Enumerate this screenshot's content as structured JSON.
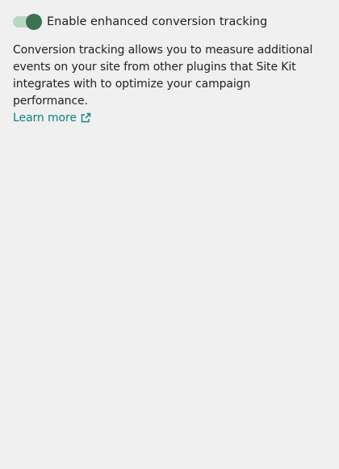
{
  "toggle": {
    "label": "Enable enhanced conversion tracking",
    "checked": true,
    "track_color": "#b8d8c4",
    "thumb_color": "#3c7251"
  },
  "description": {
    "text": "Conversion tracking allows you to measure additional events on your site from other plugins that Site Kit integrates with to optimize your campaign performance.",
    "link_label": "Learn more",
    "link_icon": "external-link-icon",
    "link_color": "#108080"
  }
}
